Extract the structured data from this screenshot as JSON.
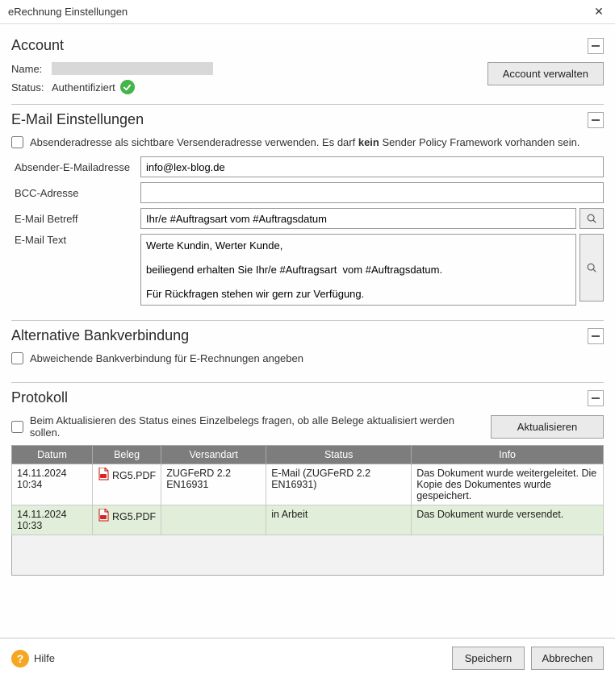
{
  "window": {
    "title": "eRechnung Einstellungen"
  },
  "account": {
    "heading": "Account",
    "name_label": "Name:",
    "status_label": "Status:",
    "status_value": "Authentifiziert",
    "manage_button": "Account verwalten"
  },
  "email": {
    "heading": "E-Mail Einstellungen",
    "sender_visible_prefix": "Absenderadresse als sichtbare Versenderadresse verwenden. Es darf ",
    "sender_visible_bold": "kein",
    "sender_visible_suffix": " Sender Policy Framework vorhanden sein.",
    "from_label": "Absender-E-Mailadresse",
    "from_value": "info@lex-blog.de",
    "bcc_label": "BCC-Adresse",
    "bcc_value": "",
    "subject_label": "E-Mail Betreff",
    "subject_value": "Ihr/e #Auftragsart vom #Auftragsdatum",
    "text_label": "E-Mail Text",
    "text_value": "Werte Kundin, Werter Kunde,\n\nbeiliegend erhalten Sie Ihr/e #Auftragsart  vom #Auftragsdatum.\n\nFür Rückfragen stehen wir gern zur Verfügung."
  },
  "altbank": {
    "heading": "Alternative Bankverbindung",
    "checkbox_label": "Abweichende Bankverbindung für E-Rechnungen angeben"
  },
  "protokoll": {
    "heading": "Protokoll",
    "ask_checkbox": "Beim Aktualisieren des Status eines Einzelbelegs fragen, ob alle Belege aktualisiert werden sollen.",
    "refresh_button": "Aktualisieren",
    "columns": {
      "datum": "Datum",
      "beleg": "Beleg",
      "versandart": "Versandart",
      "status": "Status",
      "info": "Info"
    },
    "rows": [
      {
        "datum": "14.11.2024 10:34",
        "beleg": "RG5.PDF",
        "versandart": "ZUGFeRD 2.2 EN16931",
        "status": "E-Mail (ZUGFeRD 2.2 EN16931)",
        "info": "Das Dokument wurde weitergeleitet. Die Kopie des Dokumentes wurde gespeichert."
      },
      {
        "datum": "14.11.2024 10:33",
        "beleg": "RG5.PDF",
        "versandart": "",
        "status": "in Arbeit",
        "info": "Das Dokument wurde versendet."
      }
    ]
  },
  "footer": {
    "help": "Hilfe",
    "save": "Speichern",
    "cancel": "Abbrechen"
  }
}
